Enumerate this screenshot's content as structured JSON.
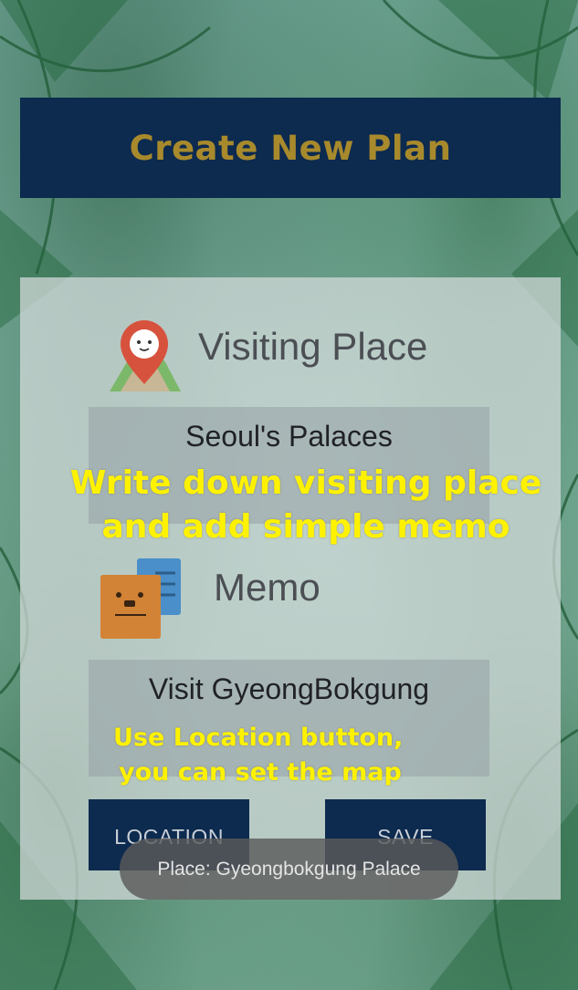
{
  "header": {
    "title": "Create New Plan"
  },
  "place": {
    "icon": "map-pin-face-icon",
    "label": "Visiting Place",
    "value": "Seoul's Palaces"
  },
  "memo": {
    "icon": "memo-notes-icon",
    "label": "Memo",
    "value": "Visit GyeongBokgung"
  },
  "buttons": {
    "location": "LOCATION",
    "save": "SAVE"
  },
  "captions": {
    "line1": "Write down visiting place",
    "line2": "and add simple memo",
    "hint1": "Use Location button,",
    "hint2": "you can set the map"
  },
  "toast": {
    "text": "Place: Gyeongbokgung Palace"
  },
  "colors": {
    "header_bg": "#0d2a4f",
    "header_text": "#a88a2c",
    "caption": "#fff200",
    "button_bg": "#0d2a4f"
  }
}
